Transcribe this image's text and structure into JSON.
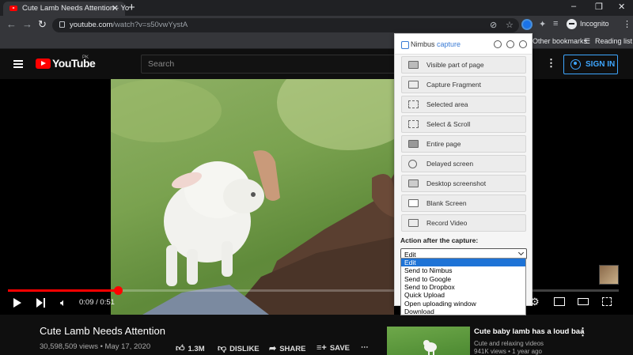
{
  "browser": {
    "tab_title": "Cute Lamb Needs Attention - Yo",
    "tab_close": "✕",
    "new_tab": "+",
    "url_host": "youtube.com",
    "url_path": "/watch?v=s50vwYystA",
    "profile_label": "Incognito",
    "bookmarks": [
      "Other bookmarks",
      "Reading list"
    ],
    "window_controls": [
      "–",
      "❐",
      "✕"
    ]
  },
  "youtube": {
    "logo_text": "YouTube",
    "country_code": "PK",
    "search_placeholder": "Search",
    "signin_label": "SIGN IN",
    "more_label": "⋮"
  },
  "player": {
    "time": "0:09 / 0:51",
    "progress_fraction": 0.18
  },
  "video": {
    "title": "Cute Lamb Needs Attention",
    "meta": "30,598,509 views • May 17, 2020",
    "actions": {
      "like": "1.3M",
      "dislike": "DISLIKE",
      "share": "SHARE",
      "save": "SAVE",
      "more": "⋯"
    }
  },
  "related": {
    "title": "Cute baby lamb has a loud baa",
    "channel": "Cute and relaxing videos",
    "views": "941K views • 1 year ago",
    "more": "⋮"
  },
  "nimbus": {
    "brand": "Nimbus",
    "brand_accent": "capture",
    "buttons": [
      "Visible part of page",
      "Capture Fragment",
      "Selected area",
      "Select & Scroll",
      "Entire page",
      "Delayed screen",
      "Desktop screenshot",
      "Blank Screen",
      "Record Video"
    ],
    "action_label": "Action after the capture:",
    "selected_action": "Edit",
    "options": [
      "Edit",
      "Send to Nimbus",
      "Send to Google",
      "Send to Dropbox",
      "Quick Upload",
      "Open uploading window",
      "Download"
    ]
  }
}
